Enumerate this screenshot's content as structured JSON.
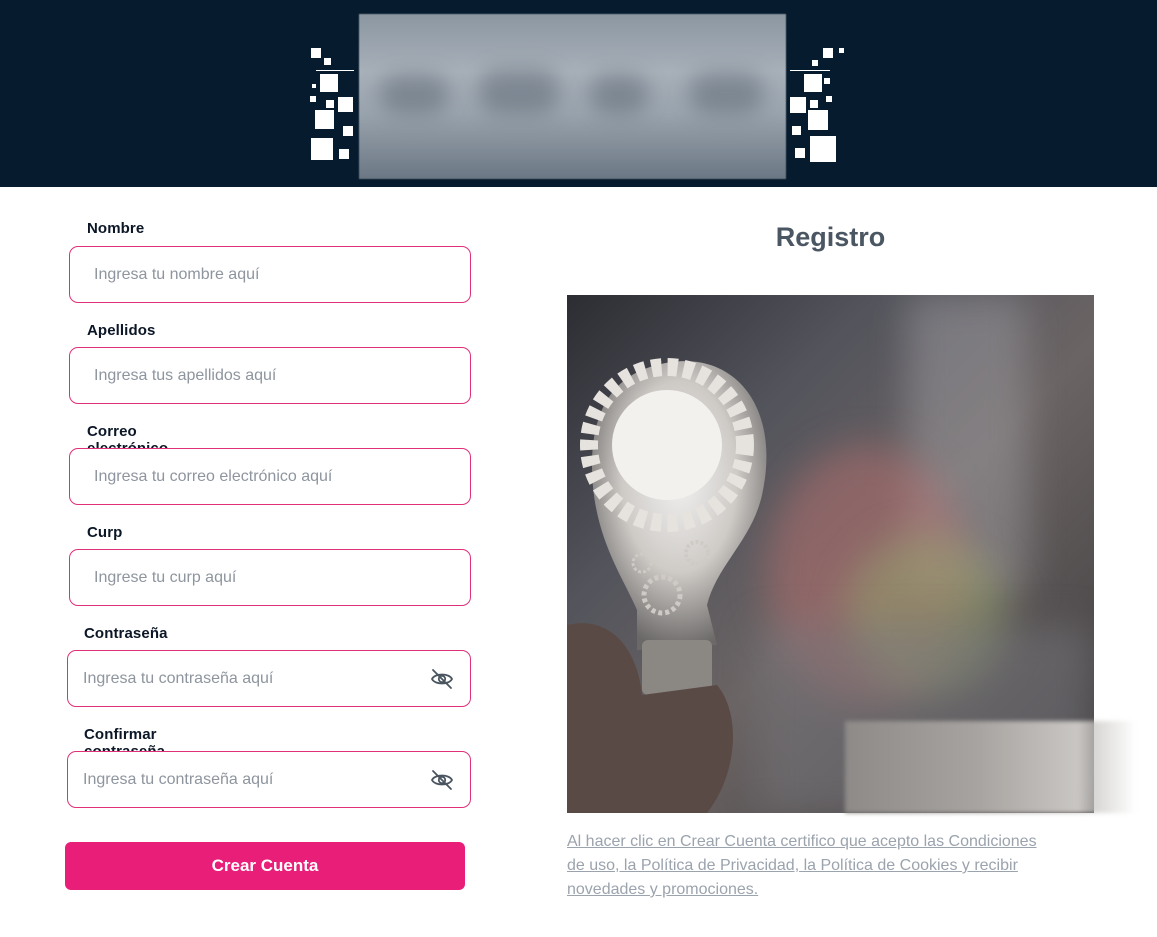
{
  "header": {
    "logo_name": "brand-logo",
    "background_color": "#061c2e"
  },
  "form": {
    "fields": [
      {
        "label": "Nombre",
        "placeholder": "Ingresa tu nombre aquí"
      },
      {
        "label": "Apellidos",
        "placeholder": "Ingresa tus apellidos aquí"
      },
      {
        "label": "Correo electrónico",
        "placeholder": "Ingresa tu correo electrónico aquí"
      },
      {
        "label": "Curp",
        "placeholder": "Ingrese tu curp aquí"
      },
      {
        "label": "Contraseña",
        "placeholder": "Ingresa tu contraseña aquí",
        "icon": "eye-off-icon"
      },
      {
        "label": "Confirmar contraseña",
        "placeholder": "Ingresa tu contraseña aquí",
        "icon": "eye-off-icon"
      }
    ],
    "submit_label": "Crear Cuenta",
    "accent_color": "#e91e78"
  },
  "aside": {
    "title": "Registro",
    "image": "lightbulb-gears-image",
    "terms_text": "Al hacer clic en Crear Cuenta certifico que acepto las Condiciones de uso, la Política de Privacidad, la Política de Cookies y recibir novedades y promociones."
  }
}
